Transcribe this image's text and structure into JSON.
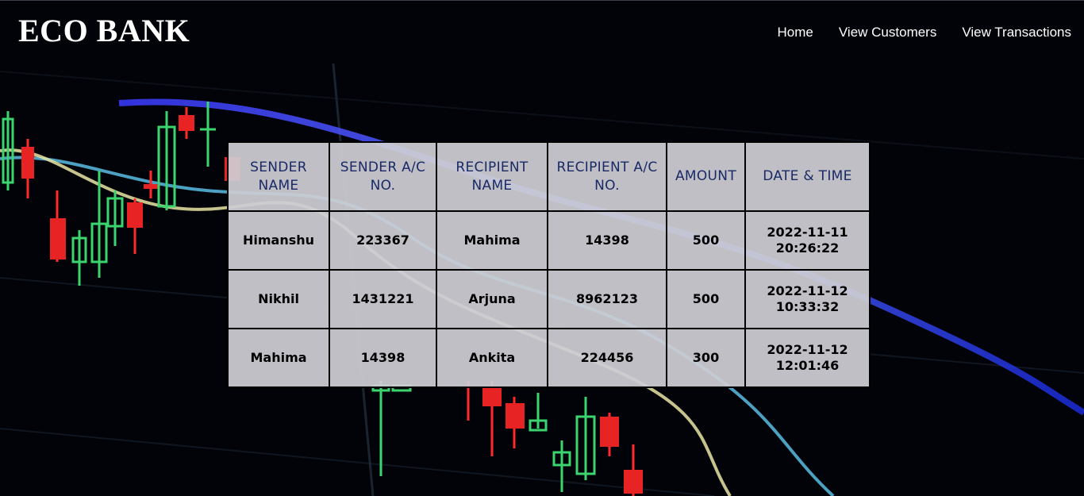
{
  "brand": "ECO BANK",
  "nav": {
    "home": "Home",
    "customers": "View Customers",
    "transactions": "View Transactions"
  },
  "table": {
    "headers": [
      "SENDER NAME",
      "SENDER A/C NO.",
      "RECIPIENT NAME",
      "RECIPIENT A/C NO.",
      "AMOUNT",
      "DATE & TIME"
    ],
    "rows": [
      [
        "Himanshu",
        "223367",
        "Mahima",
        "14398",
        "500",
        "2022-11-11 20:26:22"
      ],
      [
        "Nikhil",
        "1431221",
        "Arjuna",
        "8962123",
        "500",
        "2022-11-12 10:33:32"
      ],
      [
        "Mahima",
        "14398",
        "Ankita",
        "224456",
        "300",
        "2022-11-12 12:01:46"
      ]
    ]
  }
}
